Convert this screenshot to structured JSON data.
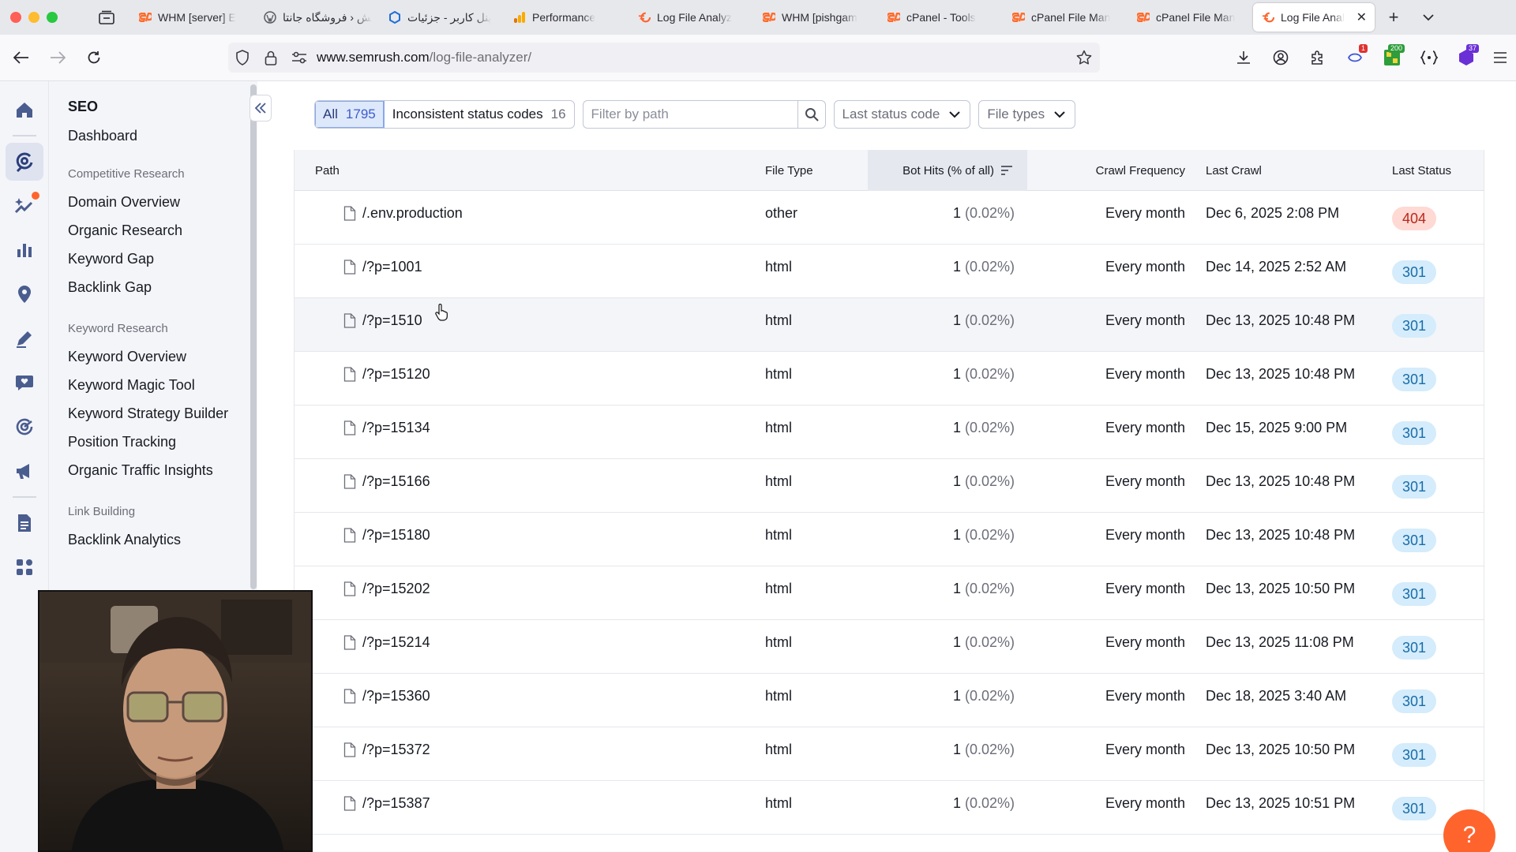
{
  "browser": {
    "tabs": [
      {
        "label": "WHM [server] E",
        "icon": "cpanel-icon"
      },
      {
        "label": "کش ‹ فروشگاه جانتا",
        "icon": "wordpress-icon"
      },
      {
        "label": "پنل کاربر - جزئیات",
        "icon": "hex-icon"
      },
      {
        "label": "Performance",
        "icon": "analytics-icon"
      },
      {
        "label": "Log File Analyz",
        "icon": "semrush-icon"
      },
      {
        "label": "WHM [pishgam",
        "icon": "cpanel-icon"
      },
      {
        "label": "cPanel - Tools",
        "icon": "cpanel-icon"
      },
      {
        "label": "cPanel File Man",
        "icon": "cpanel-icon"
      },
      {
        "label": "cPanel File Man",
        "icon": "cpanel-icon"
      },
      {
        "label": "Log File Anal",
        "icon": "semrush-icon",
        "active": true
      }
    ],
    "url_host": "www.semrush.com",
    "url_path": "/log-file-analyzer/",
    "ext_badges": {
      "mail": "1",
      "green": "200",
      "purple": "37"
    }
  },
  "sidebar": {
    "title": "SEO",
    "dashboard": "Dashboard",
    "sections": [
      {
        "label": "Competitive Research",
        "items": [
          "Domain Overview",
          "Organic Research",
          "Keyword Gap",
          "Backlink Gap"
        ]
      },
      {
        "label": "Keyword Research",
        "items": [
          "Keyword Overview",
          "Keyword Magic Tool",
          "Keyword Strategy Builder",
          "Position Tracking",
          "Organic Traffic Insights"
        ]
      },
      {
        "label": "Link Building",
        "items": [
          "Backlink Analytics"
        ]
      }
    ]
  },
  "filters": {
    "all_label": "All",
    "all_count": "1795",
    "inconsistent_label": "Inconsistent status codes",
    "inconsistent_count": "16",
    "path_placeholder": "Filter by path",
    "status_dropdown": "Last status code",
    "types_dropdown": "File types"
  },
  "table": {
    "columns": {
      "path": "Path",
      "file_type": "File Type",
      "bot_hits": "Bot Hits (% of all)",
      "crawl_frequency": "Crawl Frequency",
      "last_crawl": "Last Crawl",
      "last_status": "Last Status"
    },
    "rows": [
      {
        "path": "/.env.production",
        "type": "other",
        "hits": "1",
        "pct": "(0.02%)",
        "freq": "Every month",
        "crawl": "Dec 6, 2025 2:08 PM",
        "status": "404"
      },
      {
        "path": "/?p=1001",
        "type": "html",
        "hits": "1",
        "pct": "(0.02%)",
        "freq": "Every month",
        "crawl": "Dec 14, 2025 2:52 AM",
        "status": "301"
      },
      {
        "path": "/?p=1510",
        "type": "html",
        "hits": "1",
        "pct": "(0.02%)",
        "freq": "Every month",
        "crawl": "Dec 13, 2025 10:48 PM",
        "status": "301"
      },
      {
        "path": "/?p=15120",
        "type": "html",
        "hits": "1",
        "pct": "(0.02%)",
        "freq": "Every month",
        "crawl": "Dec 13, 2025 10:48 PM",
        "status": "301"
      },
      {
        "path": "/?p=15134",
        "type": "html",
        "hits": "1",
        "pct": "(0.02%)",
        "freq": "Every month",
        "crawl": "Dec 15, 2025 9:00 PM",
        "status": "301"
      },
      {
        "path": "/?p=15166",
        "type": "html",
        "hits": "1",
        "pct": "(0.02%)",
        "freq": "Every month",
        "crawl": "Dec 13, 2025 10:48 PM",
        "status": "301"
      },
      {
        "path": "/?p=15180",
        "type": "html",
        "hits": "1",
        "pct": "(0.02%)",
        "freq": "Every month",
        "crawl": "Dec 13, 2025 10:48 PM",
        "status": "301"
      },
      {
        "path": "/?p=15202",
        "type": "html",
        "hits": "1",
        "pct": "(0.02%)",
        "freq": "Every month",
        "crawl": "Dec 13, 2025 10:50 PM",
        "status": "301"
      },
      {
        "path": "/?p=15214",
        "type": "html",
        "hits": "1",
        "pct": "(0.02%)",
        "freq": "Every month",
        "crawl": "Dec 13, 2025 11:08 PM",
        "status": "301"
      },
      {
        "path": "/?p=15360",
        "type": "html",
        "hits": "1",
        "pct": "(0.02%)",
        "freq": "Every month",
        "crawl": "Dec 18, 2025 3:40 AM",
        "status": "301"
      },
      {
        "path": "/?p=15372",
        "type": "html",
        "hits": "1",
        "pct": "(0.02%)",
        "freq": "Every month",
        "crawl": "Dec 13, 2025 10:50 PM",
        "status": "301"
      },
      {
        "path": "/?p=15387",
        "type": "html",
        "hits": "1",
        "pct": "(0.02%)",
        "freq": "Every month",
        "crawl": "Dec 13, 2025 10:51 PM",
        "status": "301"
      }
    ]
  },
  "help_label": "?",
  "colors": {
    "accent": "#ff642d",
    "status_404_bg": "#ffd9d3",
    "status_301_bg": "#d4ecfb",
    "active_filter": "#dde8fb"
  }
}
